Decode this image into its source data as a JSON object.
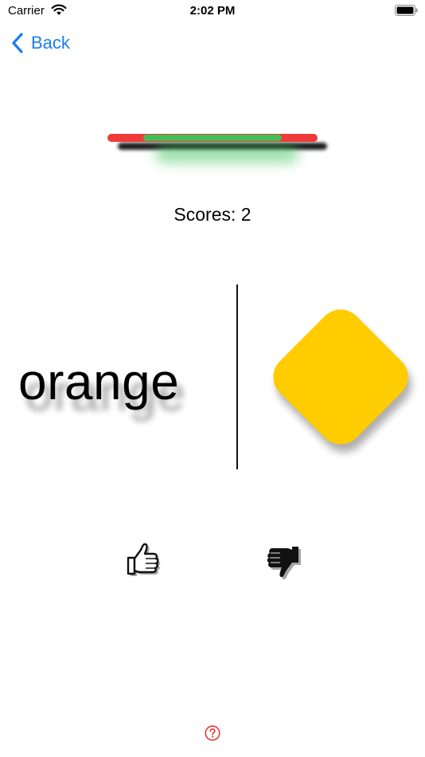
{
  "status_bar": {
    "carrier": "Carrier",
    "time": "2:02 PM"
  },
  "nav": {
    "back_label": "Back"
  },
  "timer": {
    "remaining_fraction": 0.66,
    "track_color": "#f03a3a",
    "fill_color": "#3fbf55"
  },
  "score": {
    "text": "Scores: 2"
  },
  "card": {
    "word": "orange",
    "shape": "diamond",
    "shape_color": "#ffcc00"
  },
  "answers": {
    "yes_icon": "thumbs-up-icon",
    "no_icon": "thumbs-down-icon"
  },
  "help": {
    "icon": "question-mark-icon",
    "color": "#e53935"
  },
  "colors": {
    "accent": "#1a7cf5"
  }
}
